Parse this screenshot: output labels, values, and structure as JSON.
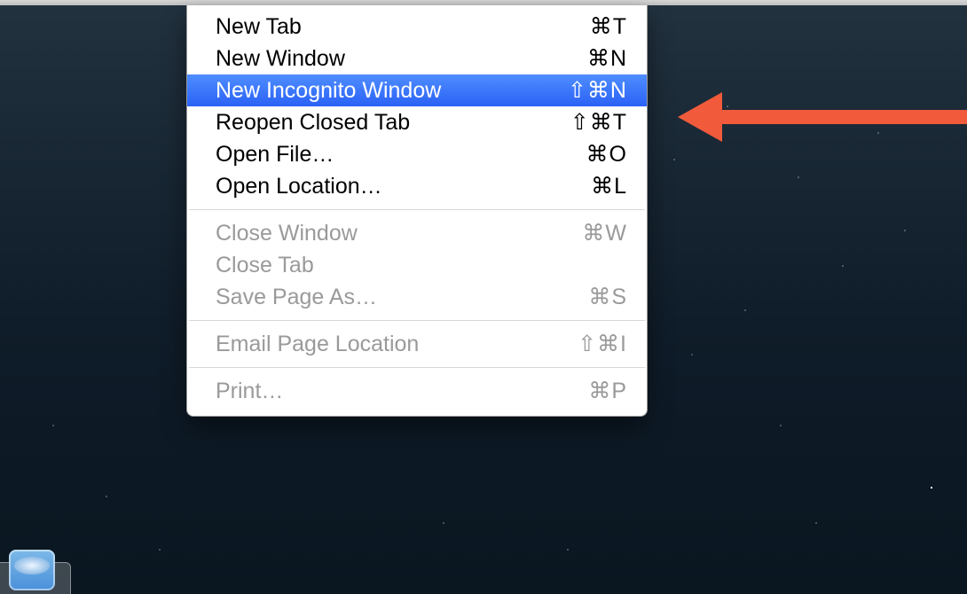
{
  "menu": {
    "sections": [
      {
        "items": [
          {
            "id": "new-tab",
            "label": "New Tab",
            "shortcut": "⌘T",
            "interactable": true,
            "highlight": false
          },
          {
            "id": "new-window",
            "label": "New Window",
            "shortcut": "⌘N",
            "interactable": true,
            "highlight": false
          },
          {
            "id": "new-incognito",
            "label": "New Incognito Window",
            "shortcut": "⇧⌘N",
            "interactable": true,
            "highlight": true
          },
          {
            "id": "reopen-closed-tab",
            "label": "Reopen Closed Tab",
            "shortcut": "⇧⌘T",
            "interactable": true,
            "highlight": false
          },
          {
            "id": "open-file",
            "label": "Open File…",
            "shortcut": "⌘O",
            "interactable": true,
            "highlight": false
          },
          {
            "id": "open-location",
            "label": "Open Location…",
            "shortcut": "⌘L",
            "interactable": true,
            "highlight": false
          }
        ]
      },
      {
        "items": [
          {
            "id": "close-window",
            "label": "Close Window",
            "shortcut": "⌘W",
            "interactable": false,
            "highlight": false
          },
          {
            "id": "close-tab",
            "label": "Close Tab",
            "shortcut": "",
            "interactable": false,
            "highlight": false
          },
          {
            "id": "save-page-as",
            "label": "Save Page As…",
            "shortcut": "⌘S",
            "interactable": false,
            "highlight": false
          }
        ]
      },
      {
        "items": [
          {
            "id": "email-page-location",
            "label": "Email Page Location",
            "shortcut": "⇧⌘I",
            "interactable": false,
            "highlight": false
          }
        ]
      },
      {
        "items": [
          {
            "id": "print",
            "label": "Print…",
            "shortcut": "⌘P",
            "interactable": false,
            "highlight": false
          }
        ]
      }
    ]
  },
  "annotation": {
    "arrow_color": "#f15a3b"
  }
}
